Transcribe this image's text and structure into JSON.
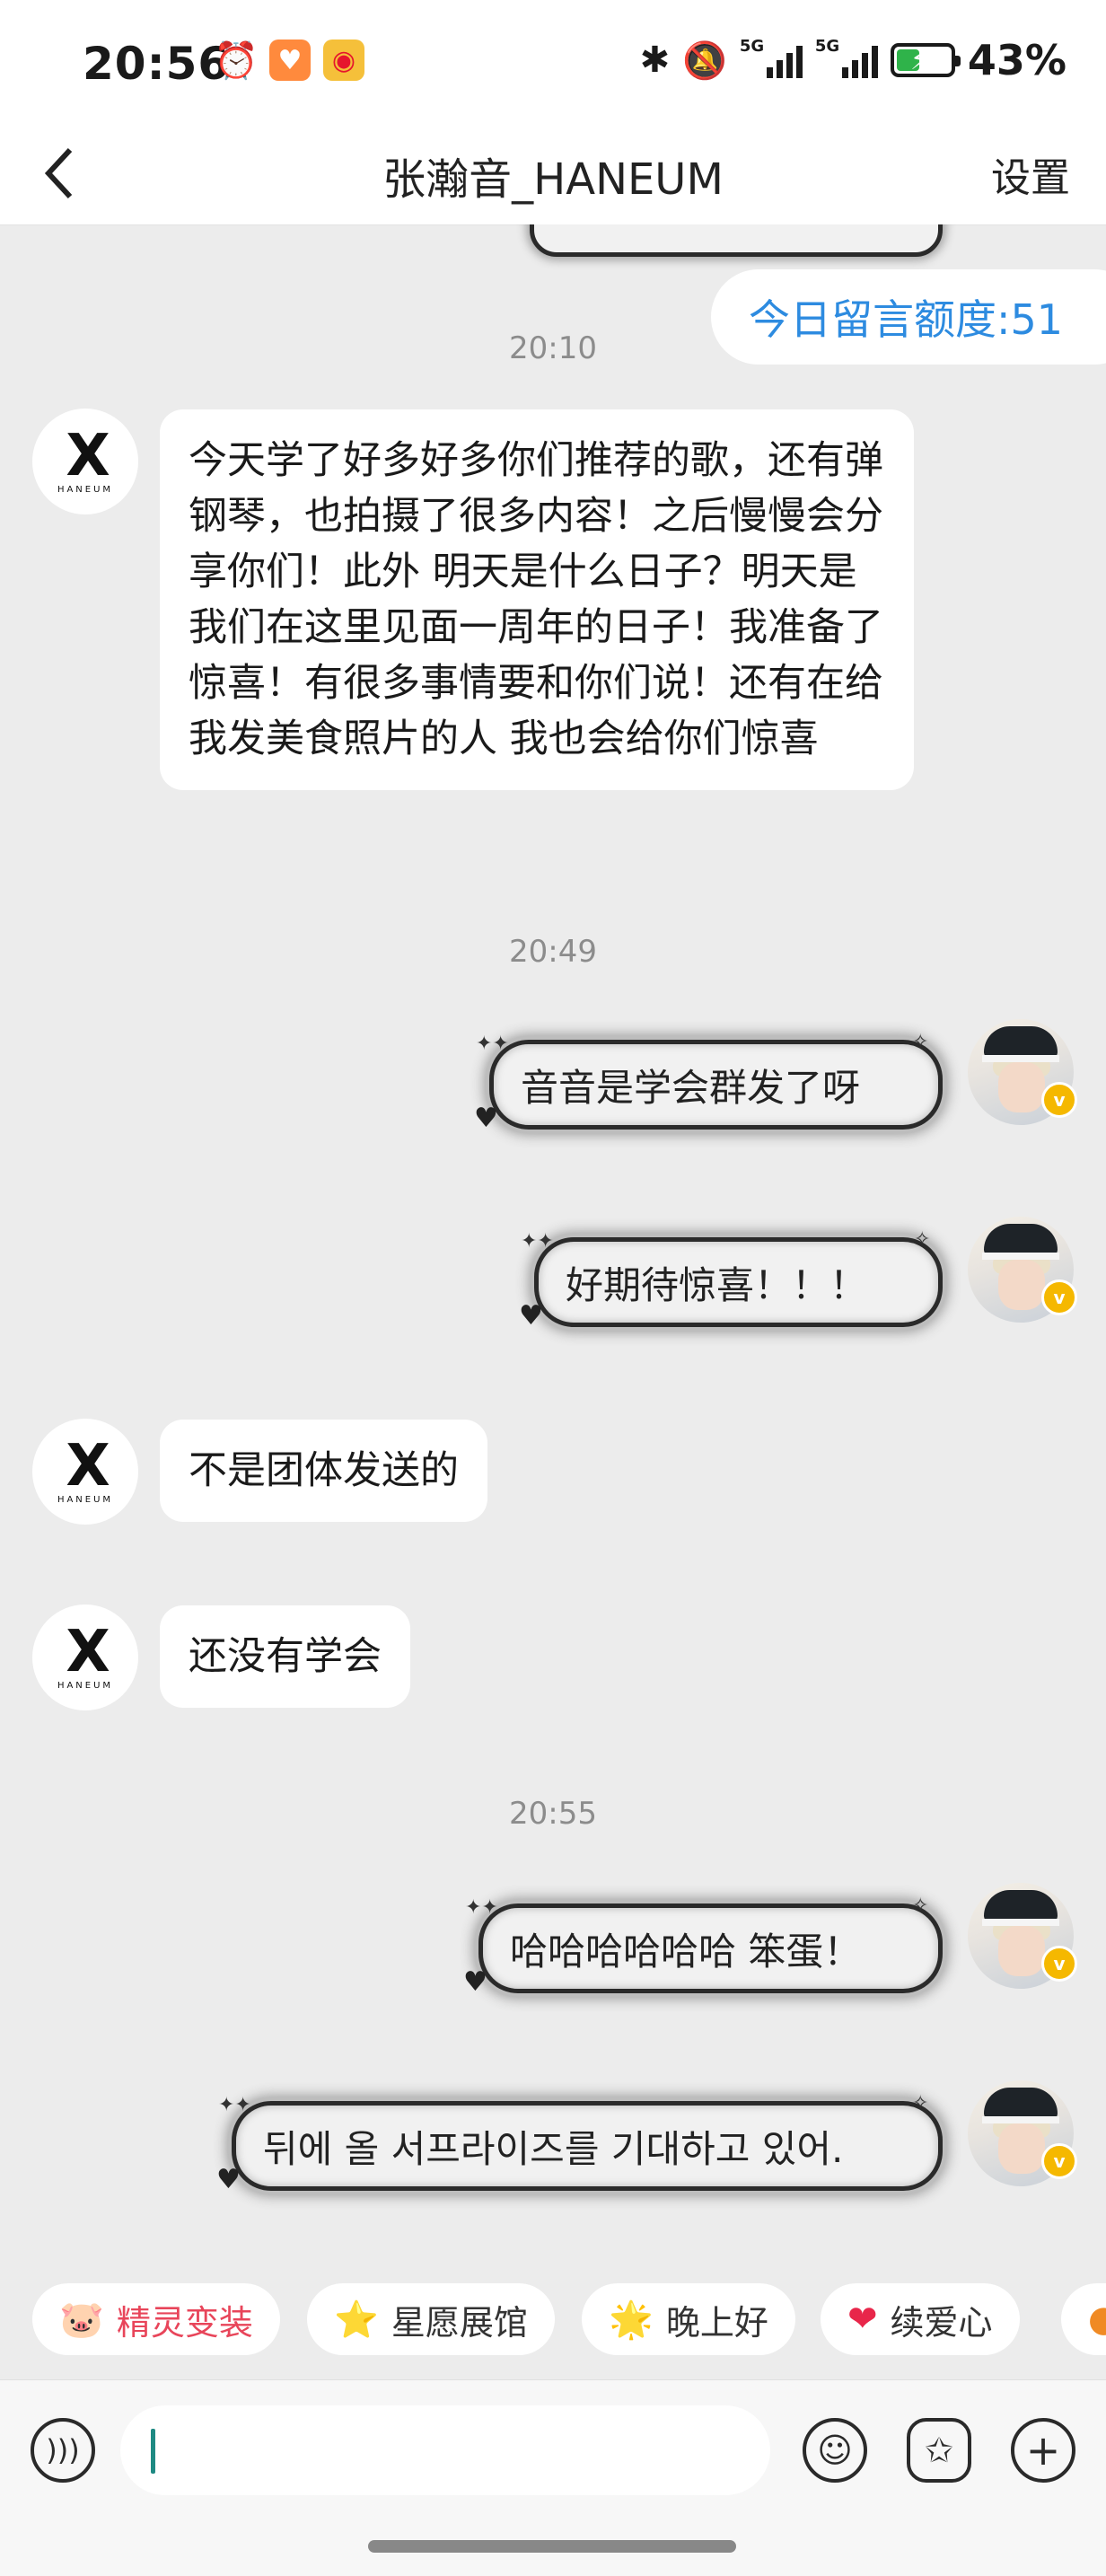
{
  "status_bar": {
    "time": "20:56",
    "left_icons": [
      "alarm-icon",
      "heart-app-icon",
      "weibo-icon"
    ],
    "right_icons": [
      "bluetooth-icon",
      "mute-icon",
      "signal-5g-icon",
      "signal-5g-icon",
      "battery-charging-icon"
    ],
    "net1": "5G",
    "net2": "5G",
    "battery_percent": "43%",
    "battery_level": 0.43
  },
  "header": {
    "back_icon": "chevron-left-icon",
    "title": "张瀚音_HANEUM",
    "settings_label": "设置"
  },
  "quota_badge": "今日留言额度:51",
  "avatar_logo": {
    "glyph": "X",
    "text": "HANEUM"
  },
  "messages": [
    {
      "type": "time",
      "text": "20:10"
    },
    {
      "type": "in",
      "text": "今天学了好多好多你们推荐的歌，还有弹钢琴，也拍摄了很多内容！之后慢慢会分享你们！此外 明天是什么日子？明天是我们在这里见面一周年的日子！我准备了惊喜！有很多事情要和你们说！还有在给我发美食照片的人 我也会给你们惊喜"
    },
    {
      "type": "time",
      "text": "20:49"
    },
    {
      "type": "out",
      "text": "音音是学会群发了呀"
    },
    {
      "type": "out",
      "text": "好期待惊喜！！！"
    },
    {
      "type": "in",
      "text": "不是团体发送的"
    },
    {
      "type": "in",
      "text": "还没有学会"
    },
    {
      "type": "time",
      "text": "20:55"
    },
    {
      "type": "out",
      "text": "哈哈哈哈哈哈 笨蛋！"
    },
    {
      "type": "out",
      "text": "뒤에 올 서프라이즈를 기대하고 있어."
    }
  ],
  "quick_chips": [
    {
      "icon": "🐷",
      "label": "精灵变装",
      "color": "#e8455a"
    },
    {
      "icon": "⭐",
      "label": "星愿展馆",
      "color": "#333333"
    },
    {
      "icon": "🌟",
      "label": "晚上好",
      "color": "#333333"
    },
    {
      "icon": "❤",
      "label": "续爱心",
      "color": "#333333"
    }
  ],
  "input_bar": {
    "voice_icon": "voice-icon",
    "emoji_icon": "emoji-icon",
    "sticker_icon": "star-sticker-icon",
    "plus_icon": "plus-icon"
  }
}
